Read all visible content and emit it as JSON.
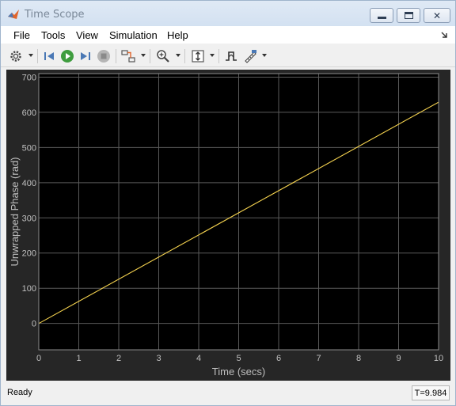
{
  "window": {
    "title": "Time Scope",
    "app_icon": "matlab-icon"
  },
  "menu": {
    "items": [
      "File",
      "Tools",
      "View",
      "Simulation",
      "Help"
    ]
  },
  "toolbar": {
    "icons": [
      "gear-icon",
      "step-back-icon",
      "run-icon",
      "step-forward-icon",
      "stop-icon",
      "highlight-signal-icon",
      "zoom-in-icon",
      "scale-axes-icon",
      "triggers-icon",
      "cursor-measurements-icon"
    ]
  },
  "status": {
    "text": "Ready",
    "time": "T=9.984"
  },
  "colors": {
    "axes_bg": "#000000",
    "panel_bg": "#262626",
    "grid": "#5a5a5a",
    "tick_text": "#bfbfbf",
    "signal": "#f5d34f"
  },
  "chart_data": {
    "type": "line",
    "title": "",
    "xlabel": "Time (secs)",
    "ylabel": "Unwrapped Phase (rad)",
    "xlim": [
      0,
      10
    ],
    "ylim": [
      -75,
      710
    ],
    "xticks": [
      "0",
      "1",
      "2",
      "3",
      "4",
      "5",
      "6",
      "7",
      "8",
      "9",
      "10"
    ],
    "yticks": [
      "0",
      "100",
      "200",
      "300",
      "400",
      "500",
      "600",
      "700"
    ],
    "grid": true,
    "series": [
      {
        "x": [
          0,
          10.1
        ],
        "y": [
          0,
          635
        ]
      }
    ]
  }
}
